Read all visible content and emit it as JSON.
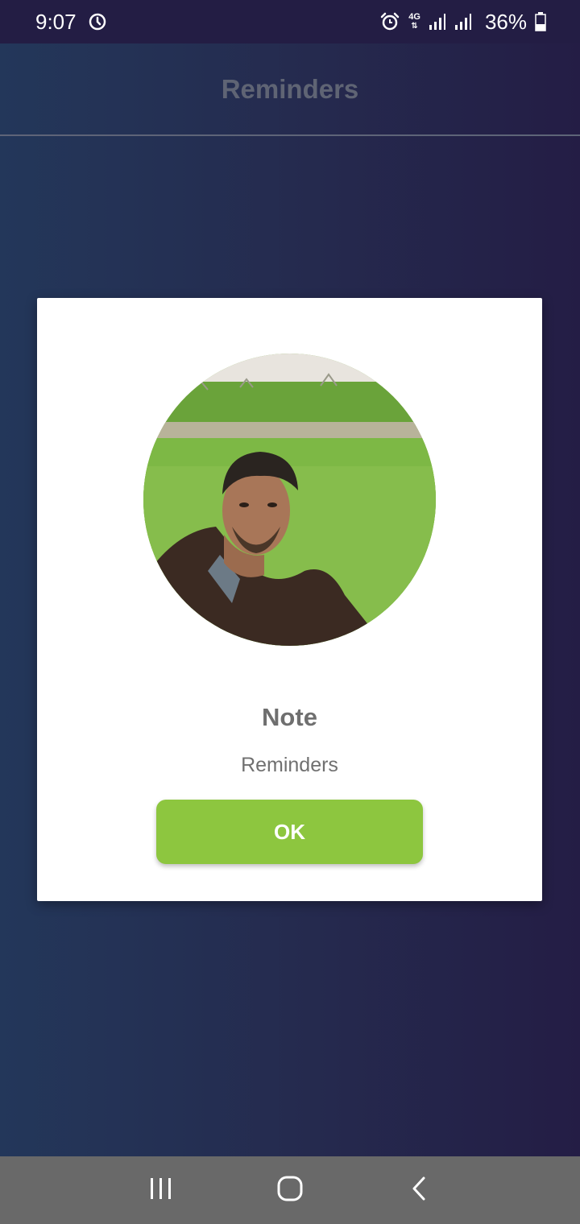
{
  "status_bar": {
    "time": "9:07",
    "sync_icon": "sync-circle-icon",
    "alarm_icon": "alarm-clock-icon",
    "network": "4G",
    "signal_icons": [
      "signal-bars-icon",
      "signal-bars-icon"
    ],
    "battery_percent": "36%",
    "battery_level": 0.36,
    "battery_icon": "battery-icon"
  },
  "app_bar": {
    "title": "Reminders"
  },
  "dialog": {
    "avatar_icon": "profile-photo",
    "title": "Note",
    "message": "Reminders",
    "ok_label": "OK"
  },
  "nav_bar": {
    "recents_icon": "recents-icon",
    "home_icon": "home-icon",
    "back_icon": "back-chevron-icon"
  },
  "colors": {
    "status_bar_bg": "#231d44",
    "gradient_left": "#23375a",
    "gradient_right": "#241d45",
    "accent_green": "#8dc63f",
    "nav_bar_bg": "#696969",
    "title_text": "#5f6474"
  }
}
